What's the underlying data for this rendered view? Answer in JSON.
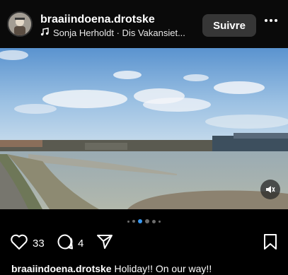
{
  "post": {
    "username": "braaiindoena.drotske",
    "audio_text": "Sonja Herholdt · Dis Vakansiet...",
    "follow_label": "Suivre",
    "icons": {
      "more": "more-options-icon",
      "music": "music-note-icon",
      "mute": "mute-icon",
      "like": "heart-icon",
      "comment": "comment-icon",
      "share": "send-icon",
      "save": "bookmark-icon"
    }
  },
  "carousel": {
    "total": 6,
    "active_index": 2
  },
  "actions": {
    "likes": "33",
    "comments": "4"
  },
  "caption": {
    "username": "braaiindoena.drotske",
    "text": " Holiday!! On our way!!"
  },
  "colors": {
    "accent_top_bar": "#1e6fd9",
    "active_dot": "#3897f0",
    "follow_bg": "#363636"
  }
}
